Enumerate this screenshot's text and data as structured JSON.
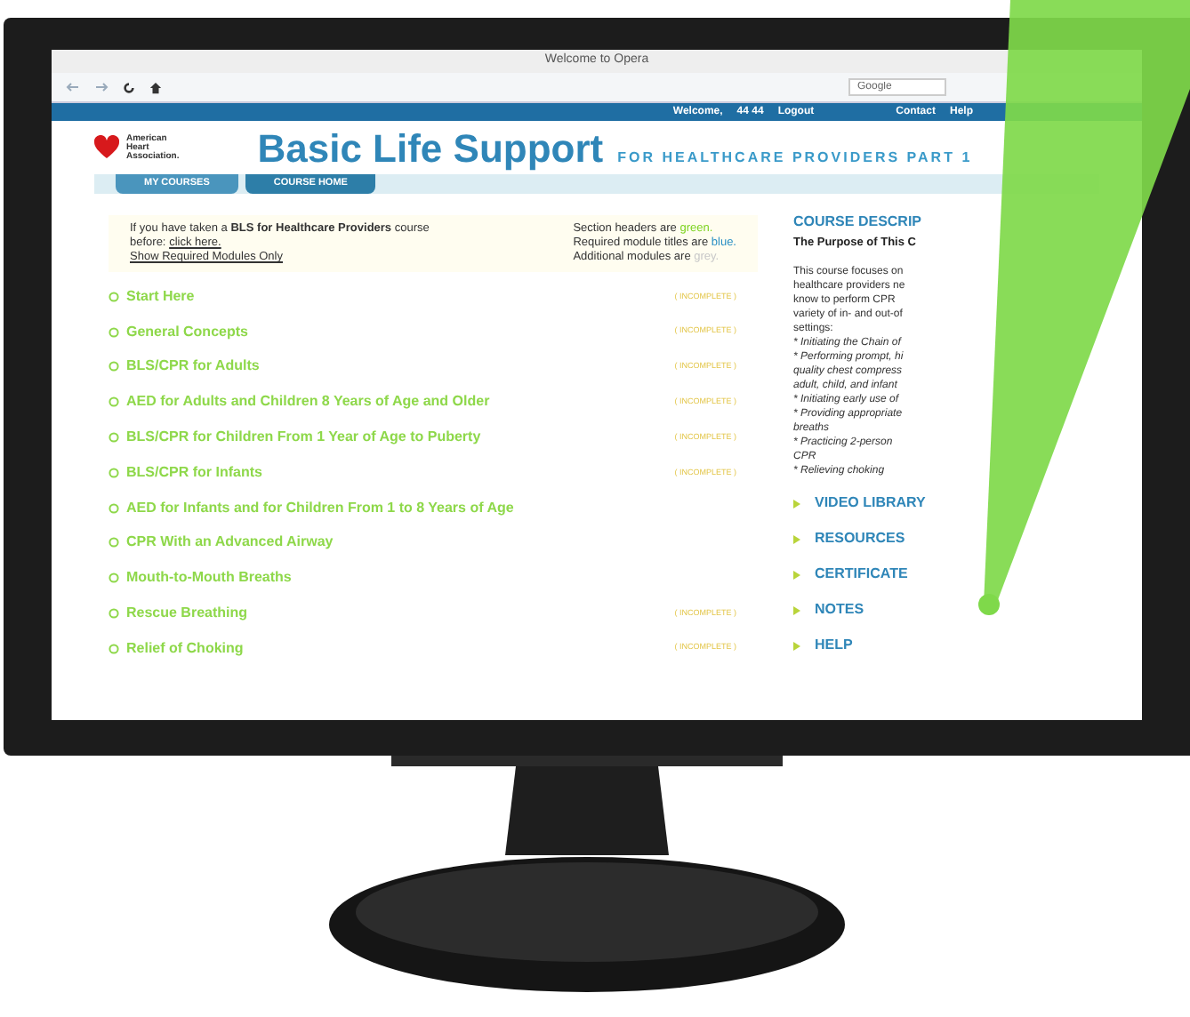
{
  "browser": {
    "title": "Welcome to Opera",
    "search_placeholder": "Google"
  },
  "topbar": {
    "welcome": "Welcome,",
    "user": "44 44",
    "logout": "Logout",
    "links": [
      "Contact",
      "Help"
    ]
  },
  "header": {
    "logo_lines": [
      "American",
      "Heart",
      "Association."
    ],
    "title": "Basic Life Support",
    "subtitle": "FOR HEALTHCARE PROVIDERS PART 1"
  },
  "tabs": [
    {
      "label": "MY COURSES",
      "selected": false
    },
    {
      "label": "COURSE HOME",
      "selected": true
    }
  ],
  "notice": {
    "text": "If you have taken a **BLS for Healthcare Providers** course before:",
    "link": "click here.",
    "filter_link": "Show Required Modules Only"
  },
  "legend": [
    {
      "text": "Section headers are",
      "word": "green.",
      "color": "#7ed321"
    },
    {
      "text": "Required module titles are",
      "word": "blue.",
      "color": "#2a8fc4"
    },
    {
      "text": "Additional modules are",
      "word": "grey.",
      "color": "#c8c8c8"
    }
  ],
  "modules": [
    {
      "title": "Start Here",
      "status": "( INCOMPLETE )"
    },
    {
      "title": "General Concepts",
      "status": "( INCOMPLETE )"
    },
    {
      "title": "BLS/CPR for Adults",
      "status": "( INCOMPLETE )"
    },
    {
      "title": "AED for Adults and Children 8 Years of Age and Older",
      "status": "( INCOMPLETE )"
    },
    {
      "title": "BLS/CPR for Children From 1 Year of Age to Puberty",
      "status": "( INCOMPLETE )"
    },
    {
      "title": "BLS/CPR for Infants",
      "status": "( INCOMPLETE )"
    },
    {
      "title": "AED for Infants and for Children From 1 to 8 Years of Age"
    },
    {
      "title": "CPR With an Advanced Airway"
    },
    {
      "title": "Mouth-to-Mouth Breaths"
    },
    {
      "title": "Rescue Breathing",
      "status": "( INCOMPLETE )"
    },
    {
      "title": "Relief of Choking",
      "status": "( INCOMPLETE )"
    }
  ],
  "description": {
    "heading": "COURSE DESCRIP",
    "subheading": "The Purpose of This C",
    "lines": [
      {
        "kind": "plain",
        "text": "This course focuses on"
      },
      {
        "kind": "plain",
        "text": "healthcare providers ne"
      },
      {
        "kind": "plain",
        "text": "know to perform CPR"
      },
      {
        "kind": "plain",
        "text": "variety of in- and out-of"
      },
      {
        "kind": "plain",
        "text": "settings:"
      },
      {
        "kind": "bullet",
        "text": "* Initiating the Chain of"
      },
      {
        "kind": "bullet",
        "text": "* Performing prompt, hi"
      },
      {
        "kind": "bullet",
        "text": "quality chest compress"
      },
      {
        "kind": "bullet",
        "text": "adult, child, and infant"
      },
      {
        "kind": "bullet",
        "text": "* Initiating early use of"
      },
      {
        "kind": "bullet",
        "text": "* Providing appropriate"
      },
      {
        "kind": "bullet",
        "text": "breaths"
      },
      {
        "kind": "bullet",
        "text": "* Practicing 2-person"
      },
      {
        "kind": "bullet",
        "text": "CPR"
      },
      {
        "kind": "bullet",
        "text": "* Relieving choking"
      }
    ]
  },
  "sections": [
    "VIDEO LIBRARY",
    "RESOURCES",
    "CERTIFICATE",
    "NOTES",
    "HELP"
  ]
}
